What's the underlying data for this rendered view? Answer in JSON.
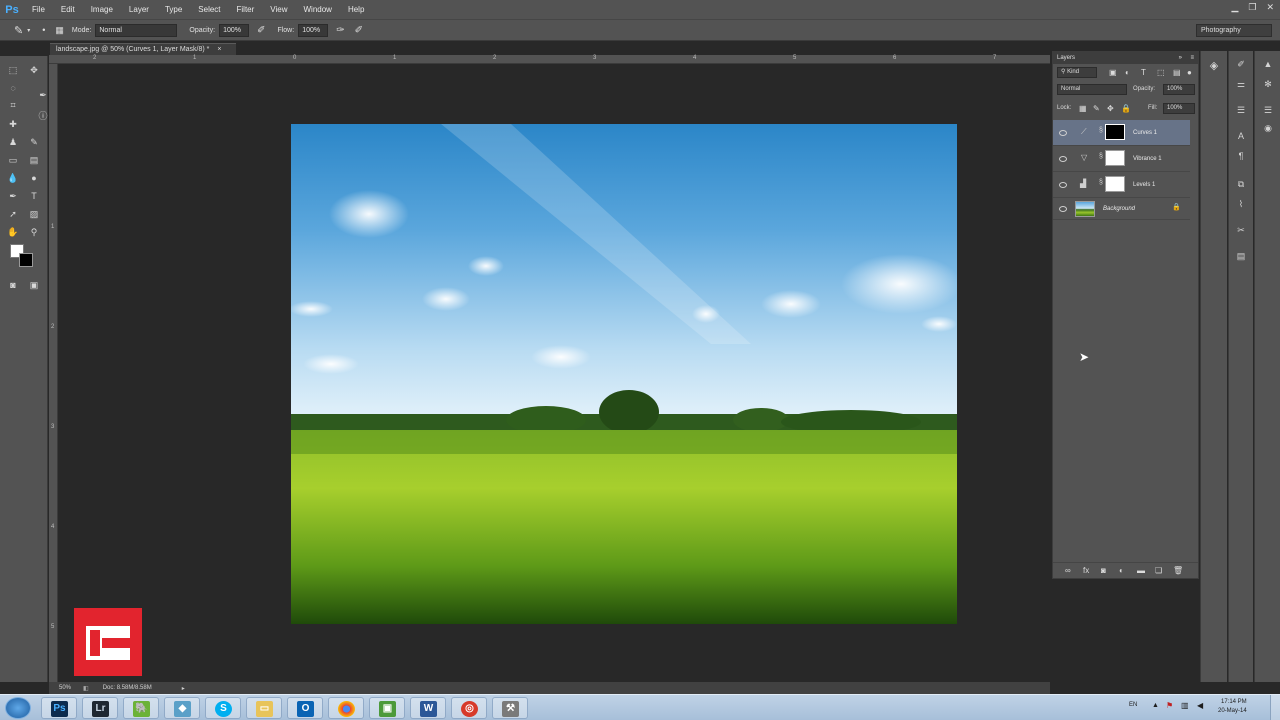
{
  "app": {
    "logo": "Ps"
  },
  "menu": [
    "File",
    "Edit",
    "Image",
    "Layer",
    "Type",
    "Select",
    "Filter",
    "View",
    "Window",
    "Help"
  ],
  "options_bar": {
    "mode_label": "Mode:",
    "mode_value": "Normal",
    "opacity_label": "Opacity:",
    "opacity_value": "100%",
    "flow_label": "Flow:",
    "flow_value": "100%",
    "workspace": "Photography"
  },
  "document_tab": {
    "title": "landscape.jpg @ 50% (Curves 1, Layer Mask/8) *",
    "close": "×"
  },
  "rulers": {
    "top": [
      "2",
      "1",
      "0",
      "1",
      "2",
      "3",
      "4",
      "5",
      "6",
      "7"
    ],
    "left": [
      "1",
      "2",
      "3",
      "4",
      "5"
    ]
  },
  "status_bar": {
    "zoom": "50%",
    "doc": "Doc: 8.58M/8.58M"
  },
  "layers_panel": {
    "title": "Layers",
    "kind_filter": "Kind",
    "blend_mode": "Normal",
    "opacity_label": "Opacity:",
    "opacity_value": "100%",
    "lock_label": "Lock:",
    "fill_label": "Fill:",
    "fill_value": "100%",
    "layers": [
      {
        "name": "Curves 1",
        "type": "curves-icon",
        "mask": "black",
        "selected": true
      },
      {
        "name": "Vibrance 1",
        "type": "vibrance-icon",
        "mask": "white",
        "selected": false
      },
      {
        "name": "Levels 1",
        "type": "levels-icon",
        "mask": "white",
        "selected": false
      },
      {
        "name": "Background",
        "type": "image",
        "mask": null,
        "selected": false,
        "locked": true
      }
    ]
  },
  "taskbar": {
    "apps": [
      "windows-start",
      "photoshop",
      "lightroom",
      "evernote",
      "app-generic",
      "skype",
      "file-explorer",
      "outlook",
      "chrome",
      "app-green",
      "word",
      "app-red",
      "app-tools"
    ],
    "app_labels": {
      "photoshop": "Ps",
      "lightroom": "Lr",
      "word": "W",
      "outlook": "O"
    },
    "language": "EN",
    "time": "17:14 PM",
    "date": "20-May-14"
  },
  "colors": {
    "accent": "#4ab0ff",
    "brand": "#e2242e",
    "selected_layer": "#677388"
  }
}
